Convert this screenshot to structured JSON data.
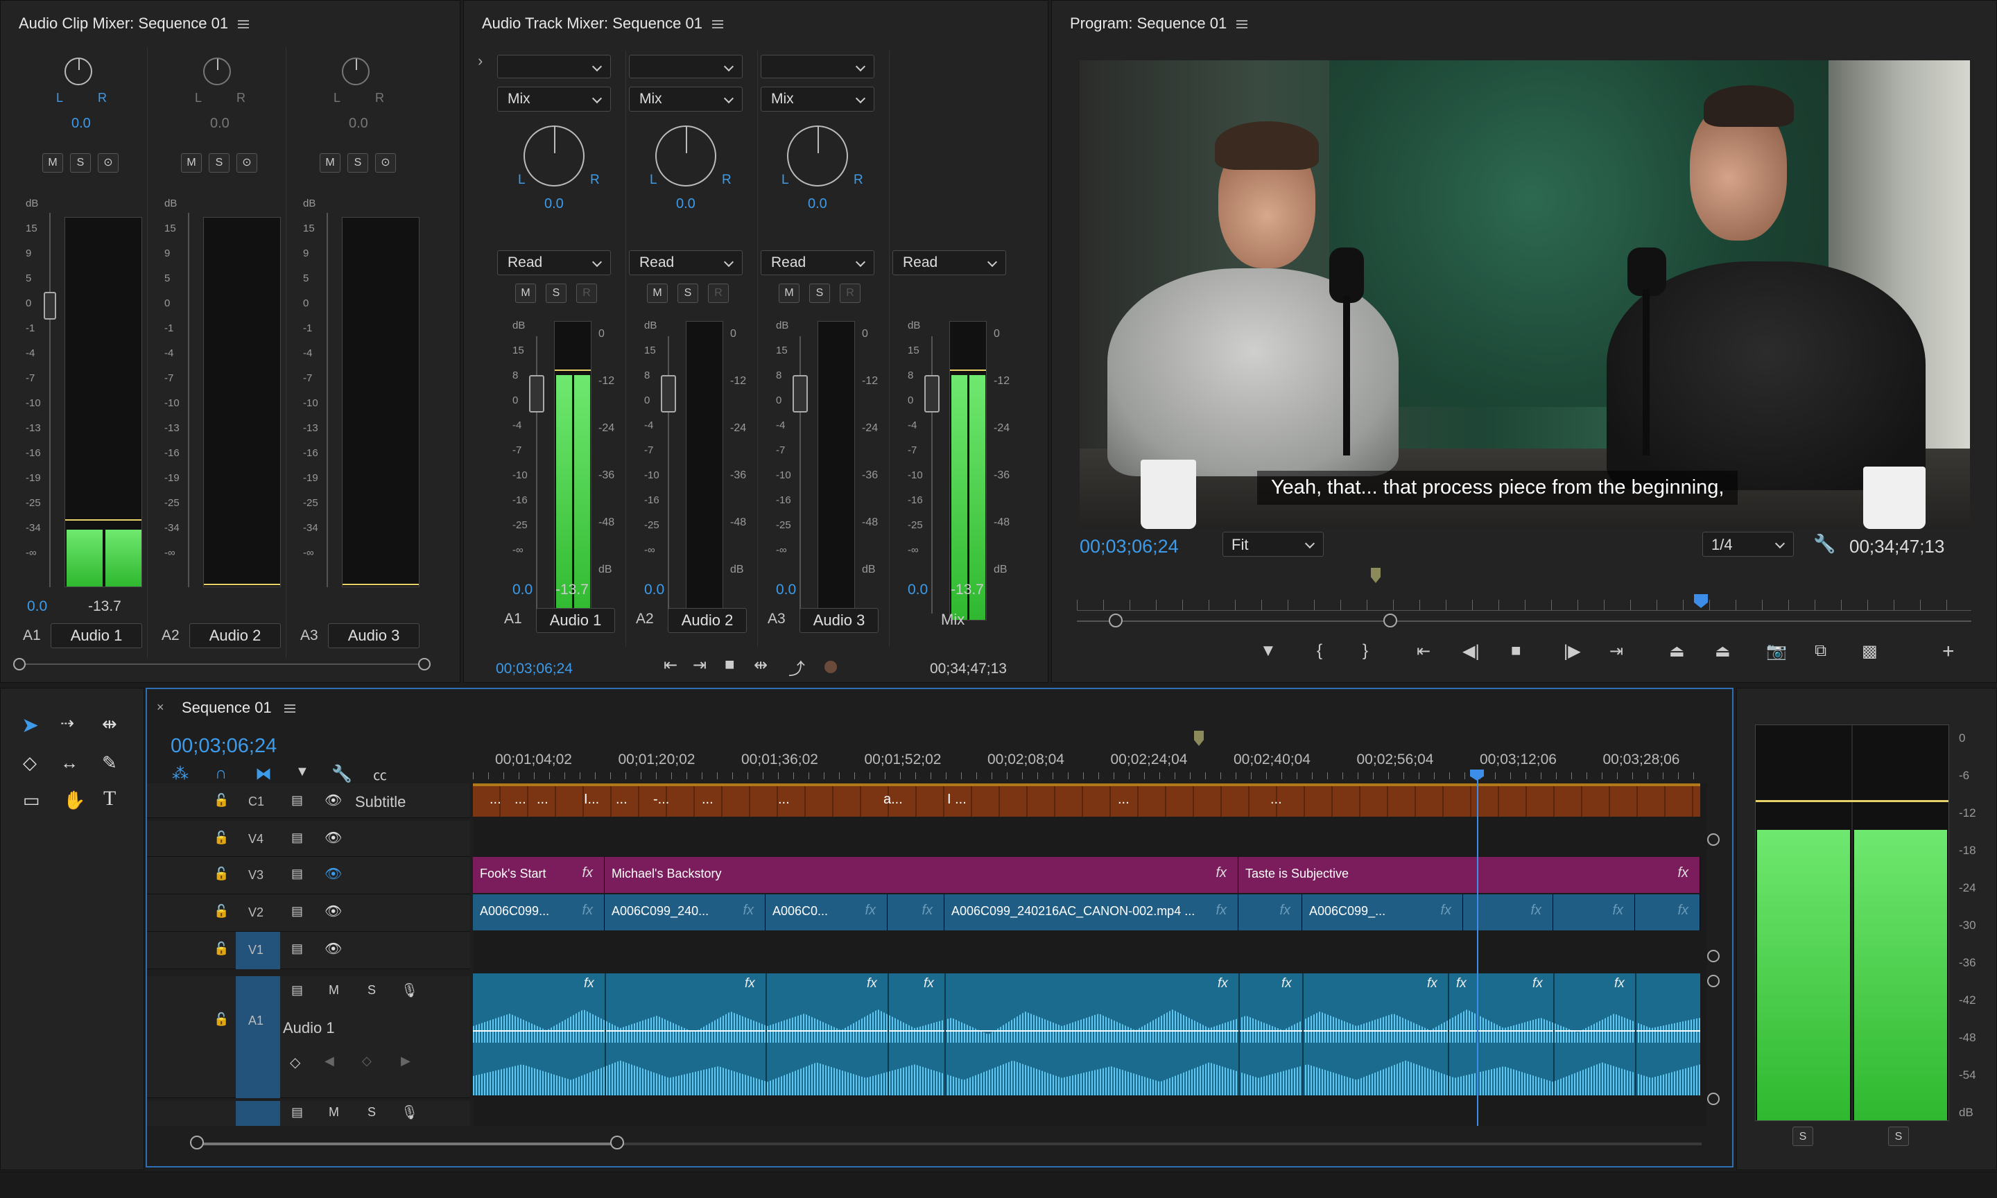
{
  "clip_mixer": {
    "title": "Audio Clip Mixer: Sequence 01",
    "channels": [
      {
        "id": "A1",
        "name": "Audio 1",
        "pan": "0.0",
        "vol": "0.0",
        "peak": "-13.7",
        "level": 0.35
      },
      {
        "id": "A2",
        "name": "Audio 2",
        "pan": "0.0",
        "vol": "",
        "peak": "",
        "level": 0
      },
      {
        "id": "A3",
        "name": "Audio 3",
        "pan": "0.0",
        "vol": "",
        "peak": "",
        "level": 0
      }
    ],
    "scale": [
      "dB",
      "15",
      "9",
      "5",
      "0",
      "-1",
      "-4",
      "-7",
      "-10",
      "-13",
      "-16",
      "-19",
      "-25",
      "-34",
      "-∞"
    ],
    "msr": [
      "M",
      "S",
      "⊙"
    ],
    "lr": [
      "L",
      "R"
    ]
  },
  "track_mixer": {
    "title": "Audio Track Mixer: Sequence 01",
    "mix_label": "Mix",
    "read_label": "Read",
    "msr": [
      "M",
      "S",
      "R"
    ],
    "lr": [
      "L",
      "R"
    ],
    "channels": [
      {
        "id": "A1",
        "name": "Audio 1",
        "pan": "0.0",
        "vol": "0.0",
        "peak": "-13.7",
        "level": 0.82
      },
      {
        "id": "A2",
        "name": "Audio 2",
        "pan": "0.0",
        "vol": "0.0",
        "peak": "",
        "level": 0
      },
      {
        "id": "A3",
        "name": "Audio 3",
        "pan": "0.0",
        "vol": "0.0",
        "peak": "",
        "level": 0
      },
      {
        "id": "",
        "name": "Mix",
        "pan": "",
        "vol": "0.0",
        "peak": "-13.7",
        "level": 0.82
      }
    ],
    "scale_left": [
      "dB",
      "15",
      "8",
      "0",
      "-4",
      "-7",
      "-10",
      "-16",
      "-25",
      "-∞"
    ],
    "scale_right": [
      "0",
      "-12",
      "-24",
      "-36",
      "-48",
      "dB"
    ],
    "timecode_in": "00;03;06;24",
    "timecode_out": "00;34;47;13"
  },
  "program": {
    "title": "Program: Sequence 01",
    "subtitle": "Yeah, that... that process piece from the beginning,",
    "timecode": "00;03;06;24",
    "fit": "Fit",
    "resolution": "1/4",
    "duration": "00;34;47;13"
  },
  "timeline": {
    "tab": "Sequence 01",
    "timecode": "00;03;06;24",
    "ruler": [
      "00;01;04;02",
      "00;01;20;02",
      "00;01;36;02",
      "00;01;52;02",
      "00;02;08;04",
      "00;02;24;04",
      "00;02;40;04",
      "00;02;56;04",
      "00;03;12;06",
      "00;03;28;06"
    ],
    "tracks": [
      {
        "id": "C1",
        "name": "Subtitle"
      },
      {
        "id": "V4",
        "name": ""
      },
      {
        "id": "V3",
        "name": ""
      },
      {
        "id": "V2",
        "name": ""
      },
      {
        "id": "V1",
        "name": ""
      },
      {
        "id": "A1",
        "name": "Audio 1"
      }
    ],
    "v3_clips": [
      {
        "label": "Fook's Start"
      },
      {
        "label": "Michael's Backstory"
      },
      {
        "label": "Taste is Subjective"
      }
    ],
    "v2_clips": [
      {
        "label": "A006C099..."
      },
      {
        "label": "A006C099_240..."
      },
      {
        "label": "A006C0..."
      },
      {
        "label": ""
      },
      {
        "label": "A006C099_240216AC_CANON-002.mp4 ..."
      },
      {
        "label": ""
      },
      {
        "label": "A006C099_..."
      },
      {
        "label": ""
      },
      {
        "label": ""
      },
      {
        "label": ""
      }
    ],
    "subtitle_snippets": [
      "...",
      "...",
      "...",
      "I...",
      "...",
      "-...",
      "...",
      "...",
      "a...",
      "I ...",
      "...",
      "..."
    ],
    "audio_labels": {
      "m": "M",
      "s": "S",
      "fx": "fx"
    }
  },
  "right_meter": {
    "scale": [
      "0",
      "-6",
      "-12",
      "-18",
      "-24",
      "-30",
      "-36",
      "-42",
      "-48",
      "-54",
      "dB"
    ],
    "solo": [
      "S",
      "S"
    ],
    "level": 0.74
  },
  "colors": {
    "accent": "#3d9be9",
    "v3": "#7b1d5c",
    "v2": "#1f5d84",
    "subtitle": "#7c3512",
    "audio": "#1a6b8e"
  }
}
